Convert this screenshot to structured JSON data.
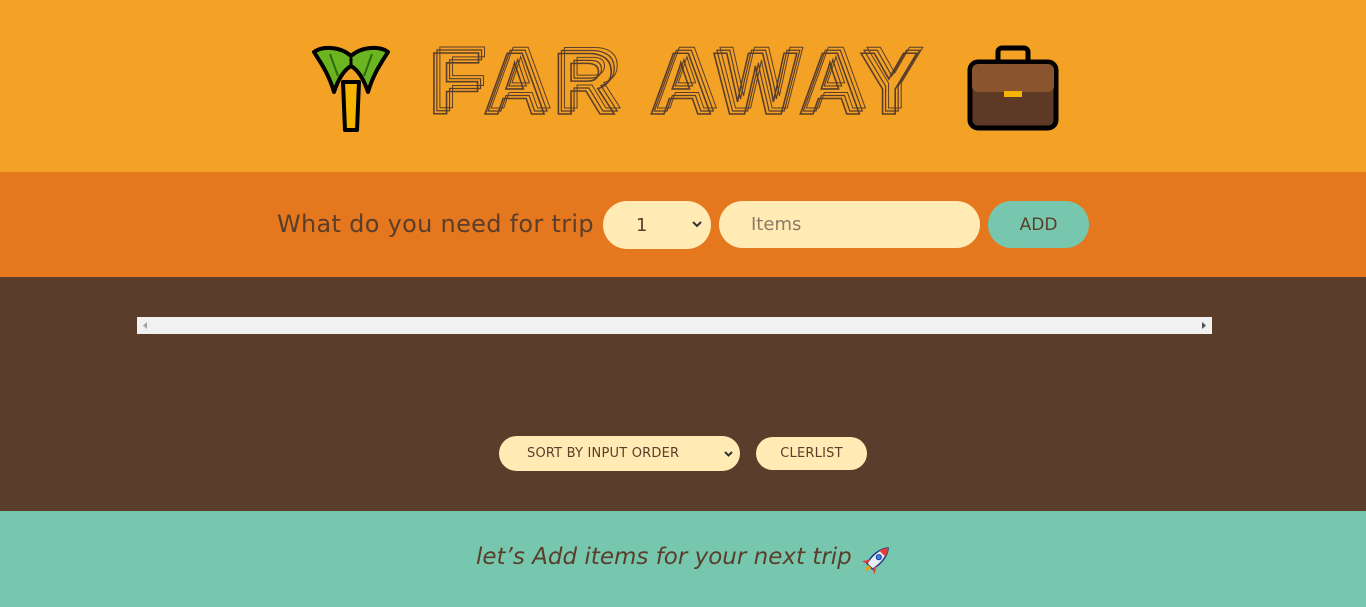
{
  "header": {
    "title": "FAR AWAY",
    "left_icon": "palm-tree-icon",
    "right_icon": "briefcase-icon"
  },
  "add_form": {
    "label": "What do you need for trip",
    "quantity_selected": "1",
    "item_placeholder": "Items",
    "add_label": "ADD"
  },
  "list": {
    "items": [],
    "sort_selected": "SORT BY INPUT ORDER",
    "clear_label": "CLERLIST"
  },
  "footer": {
    "text": "let’s Add items for your next trip",
    "icon": "rocket-icon"
  },
  "colors": {
    "header_bg": "#f4a226",
    "form_bg": "#e5771e",
    "list_bg": "#5a3e2b",
    "footer_bg": "#76c7ad",
    "input_bg": "#ffebb3",
    "text_brown": "#5a3e2b"
  }
}
